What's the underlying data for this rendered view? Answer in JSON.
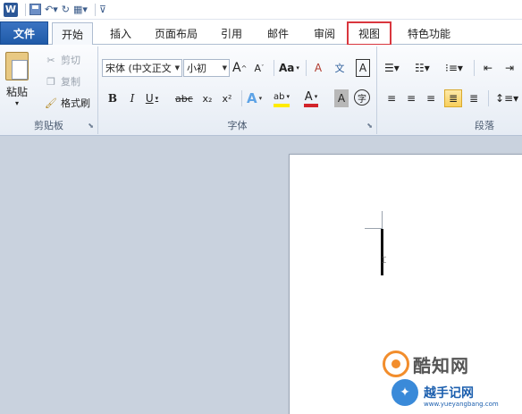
{
  "tabs": {
    "file": "文件",
    "home": "开始",
    "insert": "插入",
    "layout": "页面布局",
    "references": "引用",
    "mailings": "邮件",
    "review": "审阅",
    "view": "视图",
    "special": "特色功能"
  },
  "clipboard": {
    "paste": "粘贴",
    "cut": "剪切",
    "copy": "复制",
    "format_painter": "格式刷",
    "label": "剪贴板"
  },
  "font": {
    "name": "宋体 (中文正文",
    "size": "小初",
    "grow": "A",
    "shrink": "A",
    "case": "Aa",
    "clear": "A",
    "phonetic": "文",
    "border": "A",
    "bold": "B",
    "italic": "I",
    "underline": "U",
    "strike": "abc",
    "subscript": "x₂",
    "superscript": "x²",
    "effects": "A",
    "highlight": "ab",
    "color": "A",
    "shading": "A",
    "enclose": "字",
    "label": "字体"
  },
  "paragraph": {
    "label": "段落"
  },
  "watermark": {
    "brand1": "酷知网",
    "brand2": "越手记网",
    "url": "www.yueyangbang.com"
  },
  "colors": {
    "file_tab": "#2b5797",
    "highlight_box": "#d9363e",
    "active_align": "#f8cf5c"
  }
}
